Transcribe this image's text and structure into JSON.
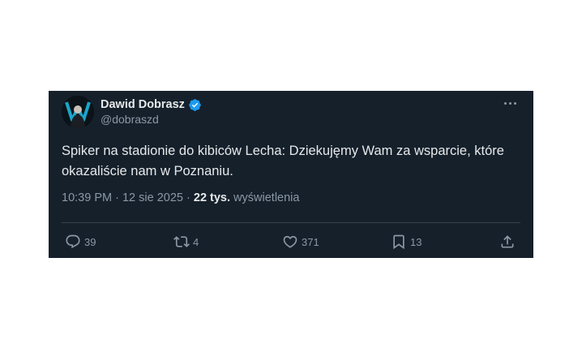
{
  "tweet": {
    "author": {
      "name": "Dawid Dobrasz",
      "handle": "@dobraszd",
      "verified": true
    },
    "text": "Spiker na stadionie do kibiców Lecha: Dziekujęmy Wam za wsparcie, które okazaliście nam w Poznaniu.",
    "time": "10:39 PM",
    "date": "12 sie 2025",
    "separator": "·",
    "views_count": "22 tys.",
    "views_label": "wyświetlenia",
    "actions": {
      "replies": "39",
      "reposts": "4",
      "likes": "371",
      "bookmarks": "13"
    },
    "icons": [
      "more-icon",
      "reply-icon",
      "repost-icon",
      "like-icon",
      "bookmark-icon",
      "share-icon",
      "verified-icon"
    ],
    "colors": {
      "background": "#15202b",
      "text": "#e7e9ea",
      "secondary": "#8b98a5",
      "verified": "#1d9bf0",
      "divider": "#38444d"
    }
  }
}
